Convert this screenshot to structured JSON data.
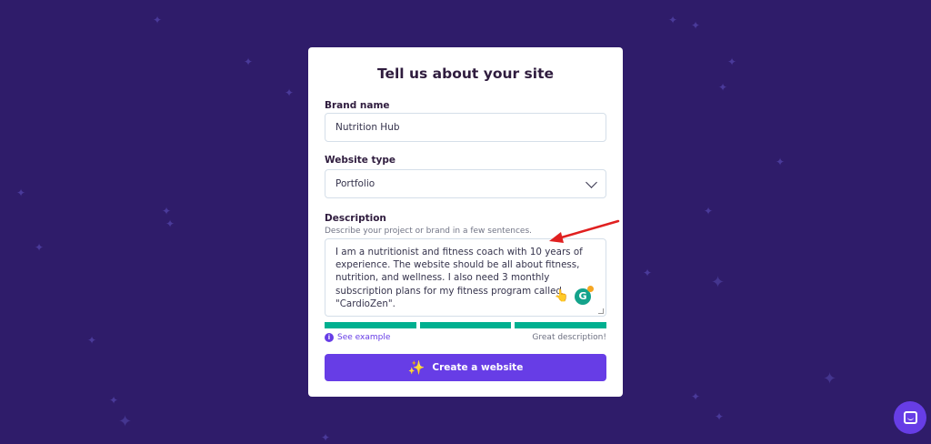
{
  "form": {
    "title": "Tell us about your site",
    "brand_label": "Brand name",
    "brand_value": "Nutrition Hub",
    "type_label": "Website type",
    "type_value": "Portfolio",
    "description_label": "Description",
    "description_hint": "Describe your project or brand in a few sentences.",
    "description_value": "I am a nutritionist and fitness coach with 10 years of experience. The website should be all about fitness, nutrition, and wellness. I also need 3 monthly subscription plans for my fitness program called \"CardioZen\".",
    "quality_bars_filled": 3,
    "quality_bars_total": 3,
    "see_example": "See example",
    "quality_text": "Great description!",
    "submit_label": "Create a website"
  },
  "icons": {
    "grammarly_letter": "G",
    "info_letter": "i"
  },
  "colors": {
    "background": "#2f1c6a",
    "accent": "#673de6",
    "progress": "#00b090",
    "annotation_arrow": "#e02020"
  }
}
